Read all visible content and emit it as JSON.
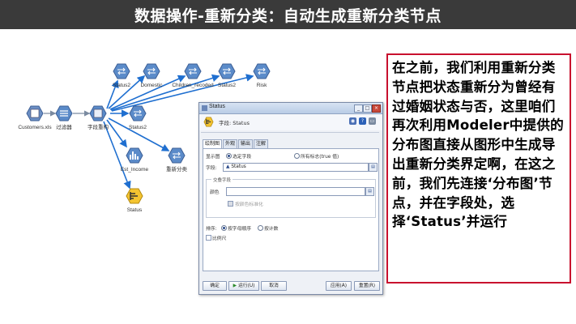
{
  "header": {
    "title": "数据操作-重新分类：自动生成重新分类节点"
  },
  "stream": {
    "nodes": [
      {
        "id": "customers",
        "label": "Customers.xls",
        "icon": "excel-source-icon"
      },
      {
        "id": "filter",
        "label": "过滤器",
        "icon": "filter-icon"
      },
      {
        "id": "type",
        "label": "字段重构",
        "icon": "type-node-icon"
      },
      {
        "id": "status2a",
        "label": "Status2",
        "icon": "reclassify-icon"
      },
      {
        "id": "domestic",
        "label": "Domestic",
        "icon": "reclassify-icon"
      },
      {
        "id": "children",
        "label": "Children_recoded",
        "icon": "reclassify-icon"
      },
      {
        "id": "status2b",
        "label": "Status2",
        "icon": "reclassify-icon"
      },
      {
        "id": "risk",
        "label": "Risk",
        "icon": "reclassify-icon"
      },
      {
        "id": "status2c",
        "label": "Status2",
        "icon": "reclassify-icon"
      },
      {
        "id": "income",
        "label": "Est_Income",
        "icon": "histogram-icon"
      },
      {
        "id": "newreclass",
        "label": "重新分类",
        "icon": "reclassify-icon"
      },
      {
        "id": "status_dist",
        "label": "Status",
        "icon": "distribution-icon"
      }
    ]
  },
  "dialog": {
    "title": "Status",
    "field_caption": "字段: Status",
    "tabs": [
      "绘制图",
      "外观",
      "输出",
      "注解"
    ],
    "show_label": "显示图",
    "radio_selected_field": "选定字段",
    "radio_all_flags": "所有标志(true 值)",
    "field_label": "字段:",
    "field_value": "Status",
    "overlay_group": "交叠字段",
    "color_label": "颜色",
    "normalize_label": "按颜色标准化",
    "sort_label": "排序:",
    "sort_alpha": "按字母顺序",
    "sort_count": "按计数",
    "proportion_label": "比例尺",
    "buttons": {
      "ok": "确定",
      "run": "运行(U)",
      "cancel": "取消",
      "apply": "应用(A)",
      "reset": "重置(R)"
    }
  },
  "callout": {
    "text": "在之前，我们利用重新分类节点把状态重新分为曾经有过婚姻状态与否，这里咱们再次利用Modeler中提供的分布图直接从图形中生成导出重新分类界定啊，在这之前，我们先连接‘分布图’节点，并在字段处，选择‘Status’并运行"
  },
  "colors": {
    "header_bg": "#3a3a3a",
    "callout_border": "#c8102e",
    "stream_arrow": "#1f6fd0",
    "node_fill": "#5b8bc9"
  }
}
